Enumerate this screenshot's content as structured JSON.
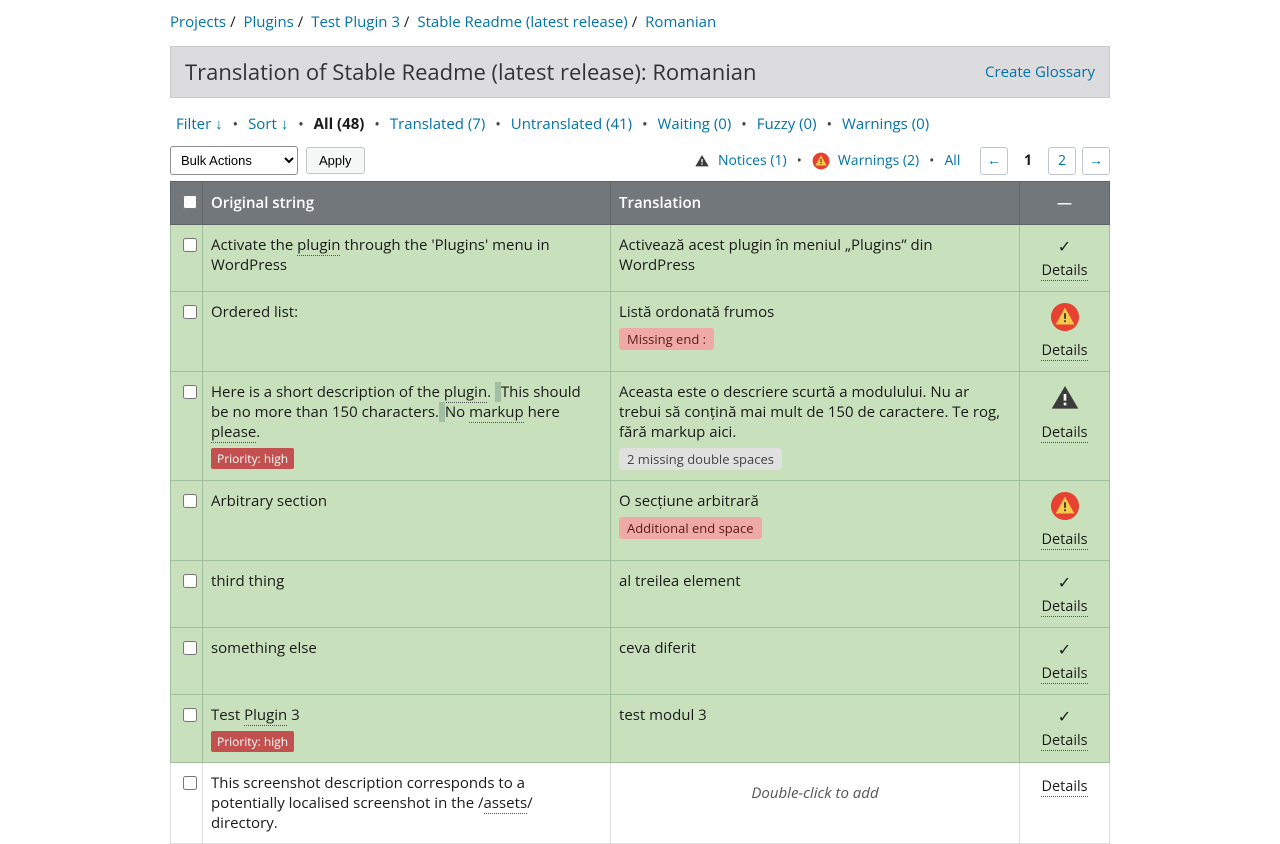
{
  "breadcrumb": [
    "Projects",
    "Plugins",
    "Test Plugin 3",
    "Stable Readme (latest release)",
    "Romanian"
  ],
  "title": "Translation of Stable Readme (latest release): Romanian",
  "create_glossary": "Create Glossary",
  "filters": {
    "filter": "Filter ↓",
    "sort": "Sort ↓",
    "all": "All (48)",
    "translated": "Translated (7)",
    "untranslated": "Untranslated (41)",
    "waiting": "Waiting (0)",
    "fuzzy": "Fuzzy (0)",
    "warnings": "Warnings (0)"
  },
  "bulk_action_label": "Bulk Actions",
  "apply_label": "Apply",
  "legend": {
    "notices": "Notices (1)",
    "warnings": "Warnings (2)",
    "all": "All"
  },
  "pager": {
    "prev": "←",
    "current": "1",
    "p2": "2",
    "next": "→"
  },
  "columns": {
    "original": "Original string",
    "translation": "Translation",
    "status": "—"
  },
  "details_label": "Details",
  "rows": [
    {
      "original_pre": "Activate the ",
      "original_dot1": "plugin",
      "original_post": " through the 'Plugins' menu in WordPress",
      "translation": "Activează acest plugin în meniul „Plugins” din WordPress",
      "status": "check"
    },
    {
      "original": "Ordered list:",
      "translation": "Listă ordonată frumos",
      "warn": "Missing end :",
      "status": "warn"
    },
    {
      "original3_a": "Here is a short description of the ",
      "original3_plugin": "plugin",
      "original3_b": ". ",
      "original3_c": "This should be no more than 150 characters.",
      "original3_d": " ",
      "original3_e": "No ",
      "original3_markup": "markup",
      "original3_f": " here ",
      "original3_please": "please",
      "original3_g": ".",
      "priority": "Priority: high",
      "translation": "Aceasta este o descriere scurtă a modulului. Nu ar trebui să conțină mai mult de 150 de caractere. Te rog, fără markup aici.",
      "notice": "2 missing double spaces",
      "status": "notice"
    },
    {
      "original": "Arbitrary section",
      "translation": "O secțiune arbitrară",
      "warn": "Additional end space",
      "status": "warn"
    },
    {
      "original": "third thing",
      "translation": "al treilea element",
      "status": "check"
    },
    {
      "original": "something else",
      "translation": "ceva diferit",
      "status": "check"
    },
    {
      "original7_a": "Test ",
      "original7_plugin": "Plugin",
      "original7_b": " 3",
      "priority": "Priority: high",
      "translation": "test modul 3",
      "status": "check"
    },
    {
      "original8_a": "This screenshot description corresponds to a potentially localised screenshot in the /",
      "original8_assets": "assets",
      "original8_b": "/ directory.",
      "empty": "Double-click to add",
      "status": "details_only"
    }
  ]
}
